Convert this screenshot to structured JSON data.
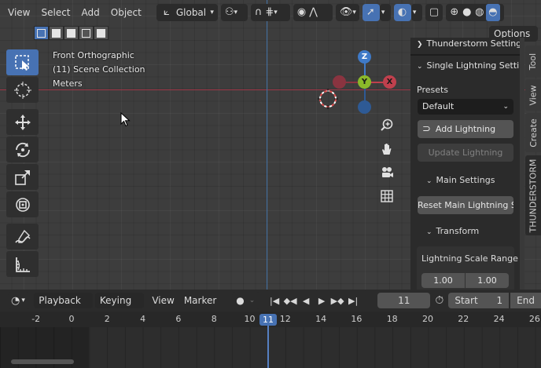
{
  "header": {
    "menus": [
      "View",
      "Select",
      "Add",
      "Object"
    ],
    "orientation": "Global",
    "options_label": "Options"
  },
  "overlay": {
    "view_name": "Front Orthographic",
    "collection": "(11) Scene Collection",
    "units": "Meters"
  },
  "gizmo": {
    "z": "Z",
    "y": "Y",
    "x": "X"
  },
  "toolbar": {
    "tools": [
      "select-box",
      "cursor",
      "move",
      "rotate",
      "scale",
      "transform",
      "annotate",
      "measure"
    ]
  },
  "npanel": {
    "top_header": "Thunderstorm Settings",
    "section": "Single Lightning Setting",
    "presets_label": "Presets",
    "presets_value": "Default",
    "add_lightning": "Add Lightning",
    "update_lightning": "Update Lightning",
    "main_settings": "Main Settings",
    "reset_main": "Reset Main Lightning S...",
    "transform": "Transform",
    "scale_range_label": "Lightning Scale Range",
    "scale_min": "1.00",
    "scale_max": "1.00"
  },
  "tabs": [
    "Tool",
    "View",
    "Create",
    "THUNDERSTORM"
  ],
  "timeline": {
    "playback": "Playback",
    "keying": "Keying",
    "view": "View",
    "marker": "Marker",
    "current_frame": "11",
    "start_label": "Start",
    "start_value": "1",
    "end_label": "End",
    "ticks": [
      "-2",
      "0",
      "2",
      "4",
      "6",
      "8",
      "10",
      "11",
      "12",
      "14",
      "16",
      "18",
      "20",
      "22",
      "24",
      "26"
    ]
  },
  "colors": {
    "accent": "#4772b3",
    "axis_x": "#a03848",
    "axis_z": "#3f6da0",
    "gizmo_x": "#c0404d",
    "gizmo_y": "#8bb82a",
    "gizmo_z": "#3f7ac8"
  }
}
